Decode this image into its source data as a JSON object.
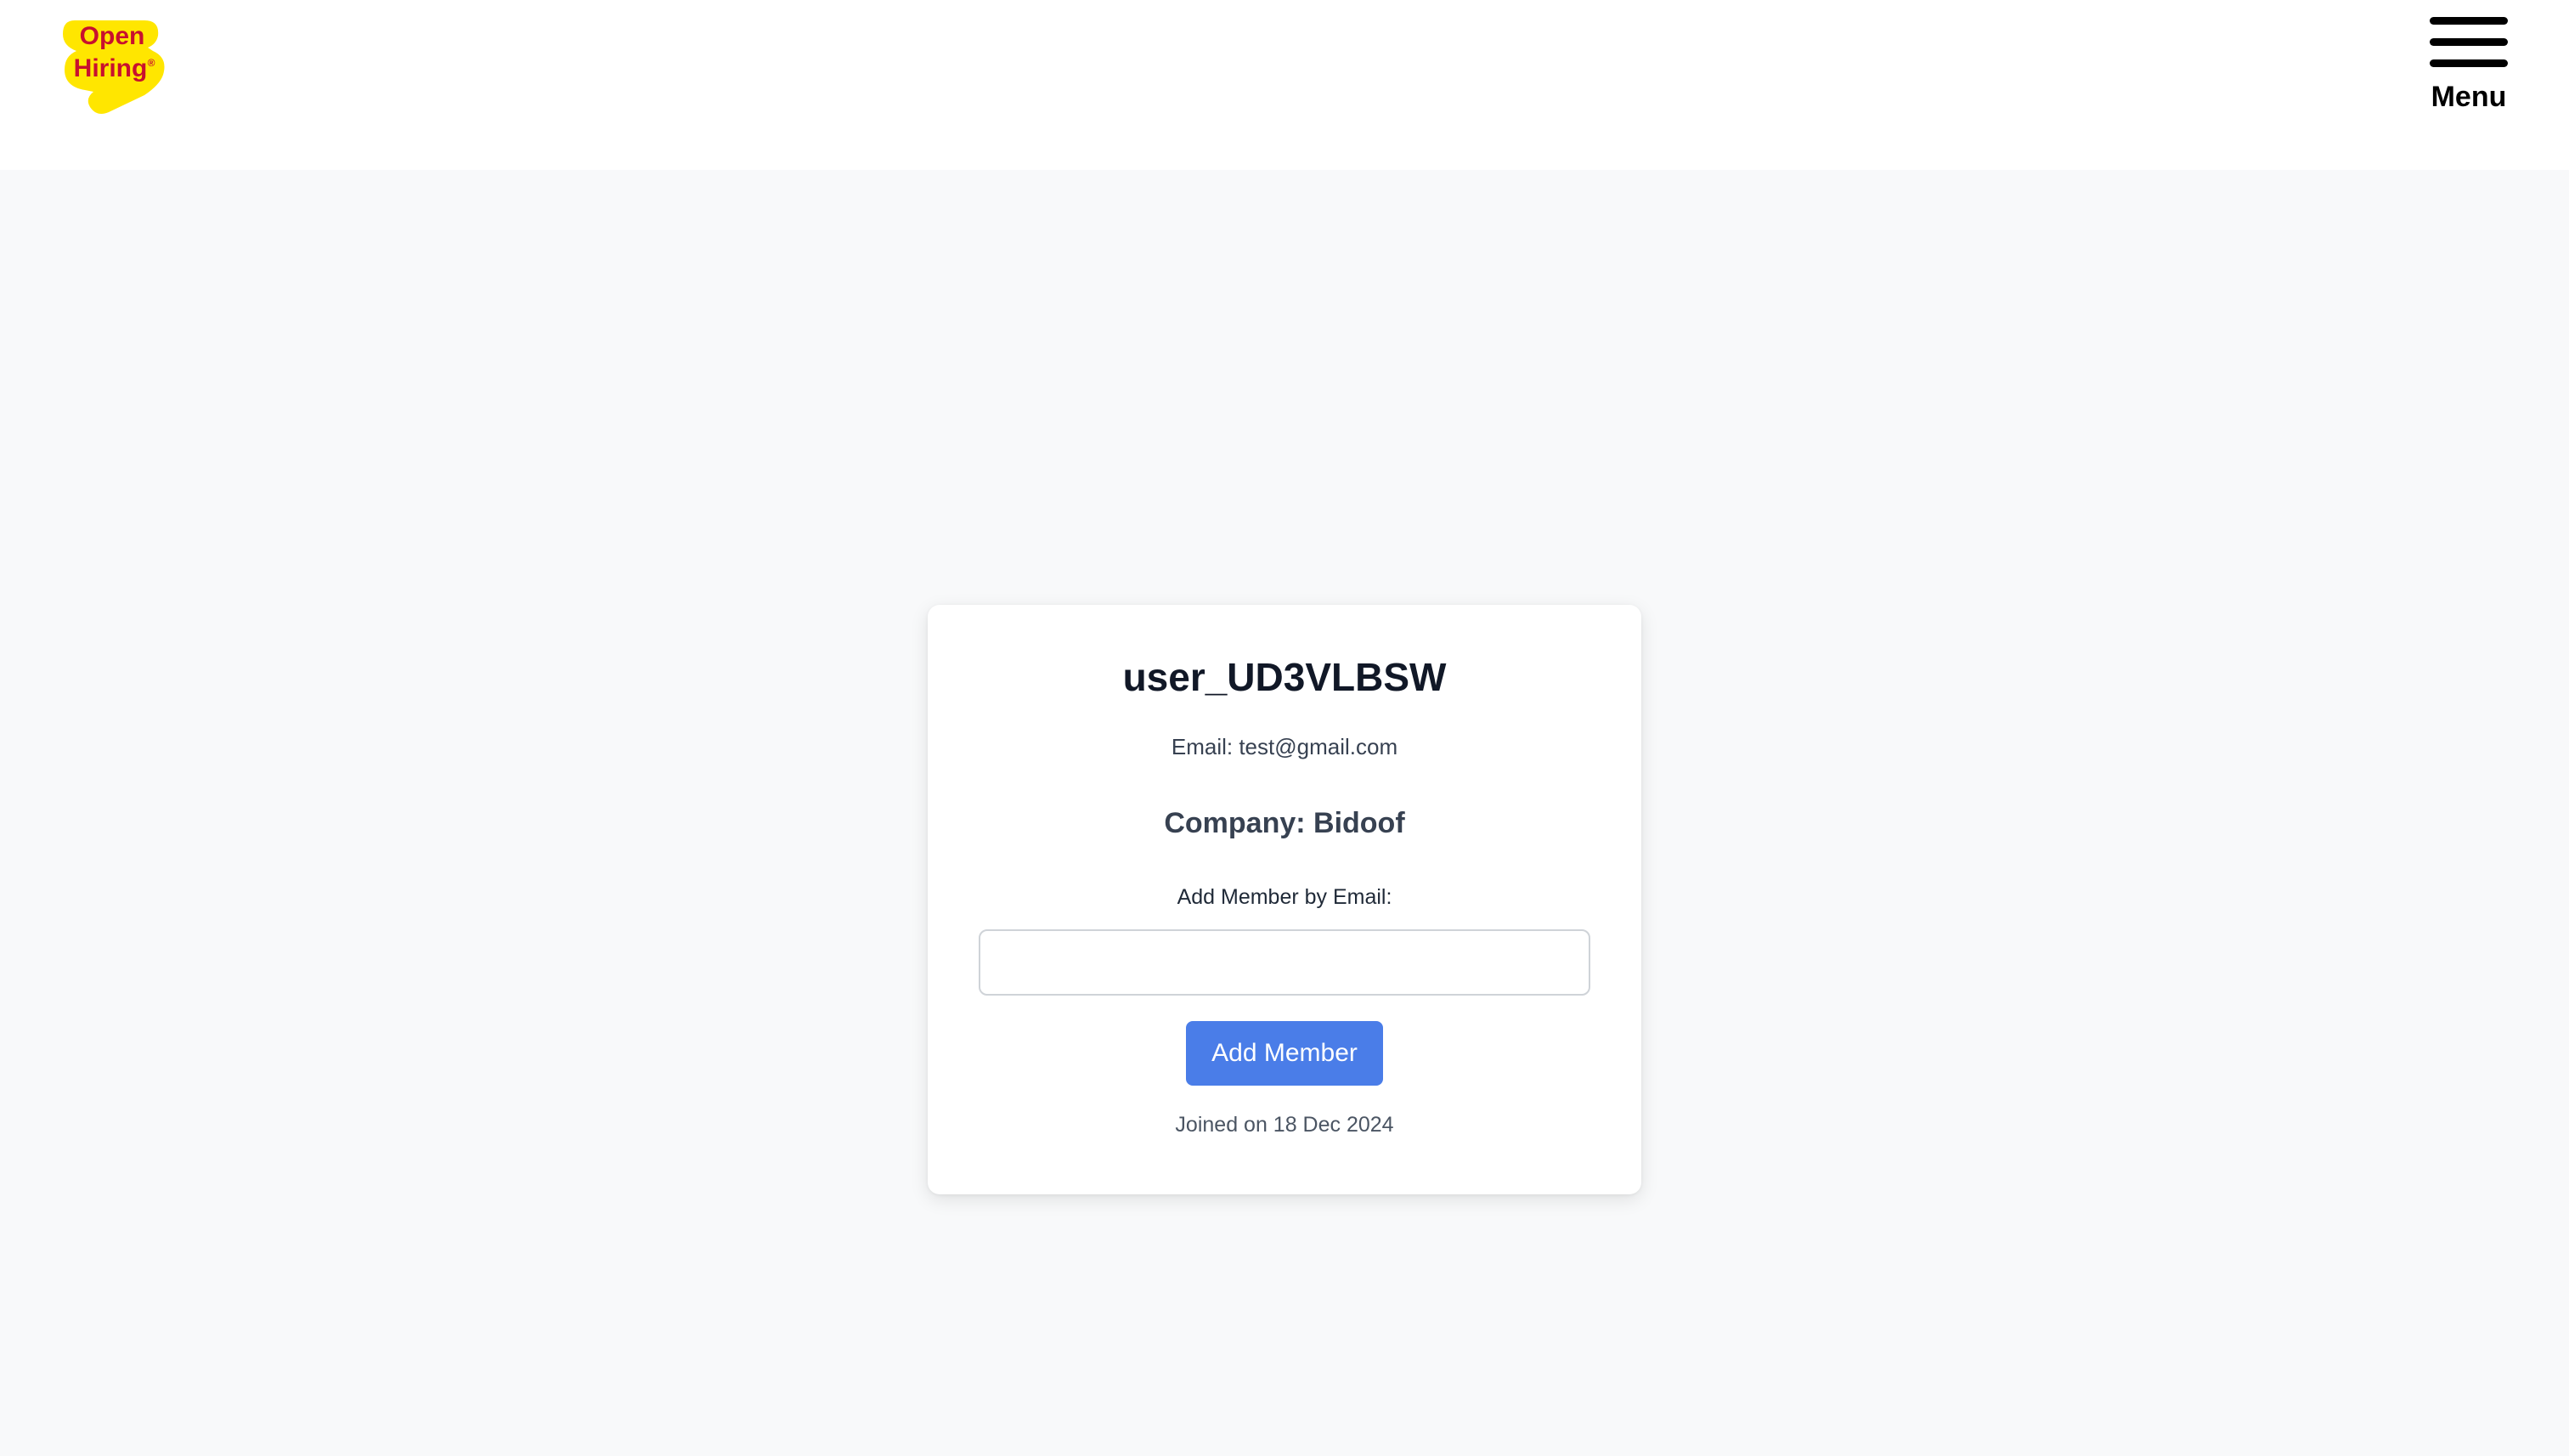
{
  "header": {
    "logo": {
      "line1": "Open",
      "line2": "Hiring",
      "mark": "®",
      "colors": {
        "background": "#ffe600",
        "text": "#c8102e"
      }
    },
    "menu": {
      "icon": "hamburger-menu-icon",
      "label": "Menu"
    }
  },
  "profile": {
    "username": "user_UD3VLBSW",
    "email": "Email: test@gmail.com",
    "company": "Company: Bidoof",
    "add_member": {
      "label": "Add Member by Email:",
      "input_value": "",
      "placeholder": "",
      "button_label": "Add Member"
    },
    "joined": "Joined on 18 Dec 2024"
  },
  "colors": {
    "page_background": "#f8f9fa",
    "header_background": "#ffffff",
    "accent": "#4a7de8"
  }
}
